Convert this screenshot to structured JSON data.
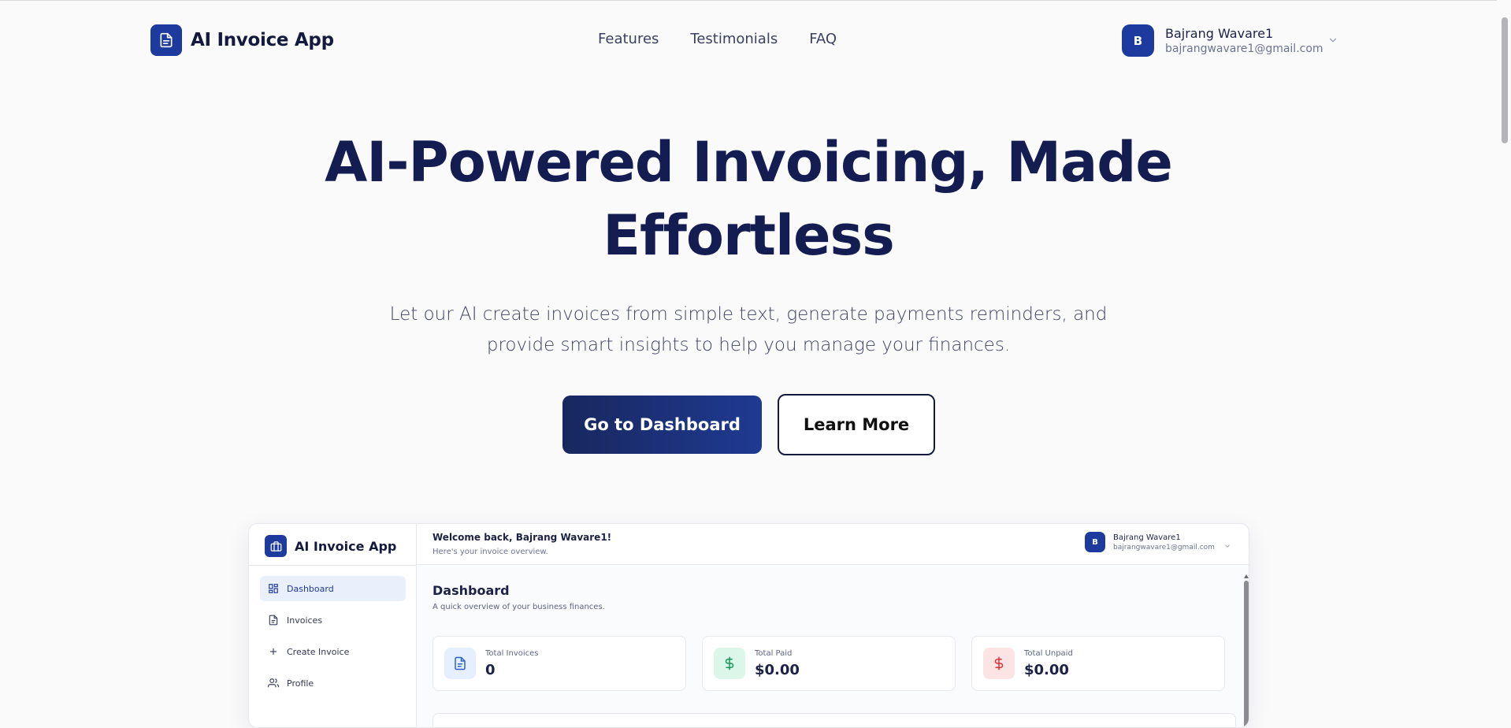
{
  "brand": {
    "name": "AI Invoice App"
  },
  "nav": [
    {
      "label": "Features"
    },
    {
      "label": "Testimonials"
    },
    {
      "label": "FAQ"
    }
  ],
  "user": {
    "initial": "B",
    "name": "Bajrang Wavare1",
    "email": "bajrangwavare1@gmail.com"
  },
  "hero": {
    "title": "AI-Powered Invoicing, Made Effortless",
    "subtitle": "Let our AI create invoices from simple text, generate payments reminders, and provide smart insights to help you manage your finances.",
    "primary_cta": "Go to Dashboard",
    "secondary_cta": "Learn More"
  },
  "preview": {
    "brand_name": "AI Invoice App",
    "welcome": "Welcome back, Bajrang Wavare1!",
    "welcome_sub": "Here's your invoice overview.",
    "user_initial": "B",
    "user_name": "Bajrang Wavare1",
    "user_email": "bajrangwavare1@gmail.com",
    "sidebar": [
      {
        "label": "Dashboard",
        "icon": "dashboard-icon",
        "active": true
      },
      {
        "label": "Invoices",
        "icon": "file-icon"
      },
      {
        "label": "Create Invoice",
        "icon": "plus-icon"
      },
      {
        "label": "Profile",
        "icon": "users-icon"
      }
    ],
    "page_title": "Dashboard",
    "page_subtitle": "A quick overview of your business finances.",
    "stats": [
      {
        "label": "Total Invoices",
        "value": "0",
        "icon": "file-icon",
        "color": "#e6efff",
        "icon_color": "#2b63c8"
      },
      {
        "label": "Total Paid",
        "value": "$0.00",
        "icon": "dollar-icon",
        "color": "#dcf7ea",
        "icon_color": "#119a57"
      },
      {
        "label": "Total Unpaid",
        "value": "$0.00",
        "icon": "dollar-icon",
        "color": "#fde4e4",
        "icon_color": "#d9303a"
      }
    ]
  },
  "colors": {
    "accent": "#1d3a9e",
    "heading": "#141d52",
    "background": "#fafafb"
  }
}
